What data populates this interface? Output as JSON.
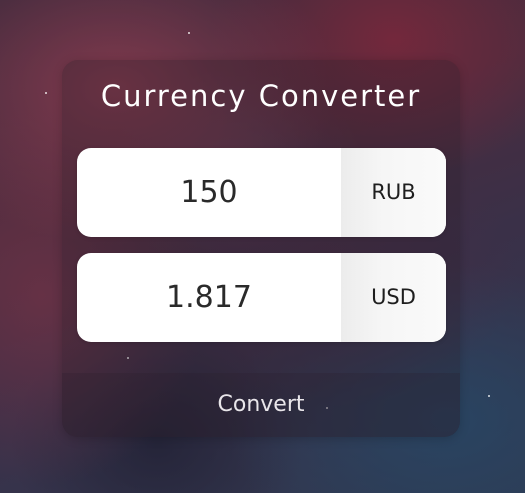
{
  "app": {
    "title": "Currency Converter"
  },
  "from": {
    "amount": "150",
    "currency": "RUB"
  },
  "to": {
    "amount": "1.817",
    "currency": "USD"
  },
  "actions": {
    "convert_label": "Convert"
  }
}
